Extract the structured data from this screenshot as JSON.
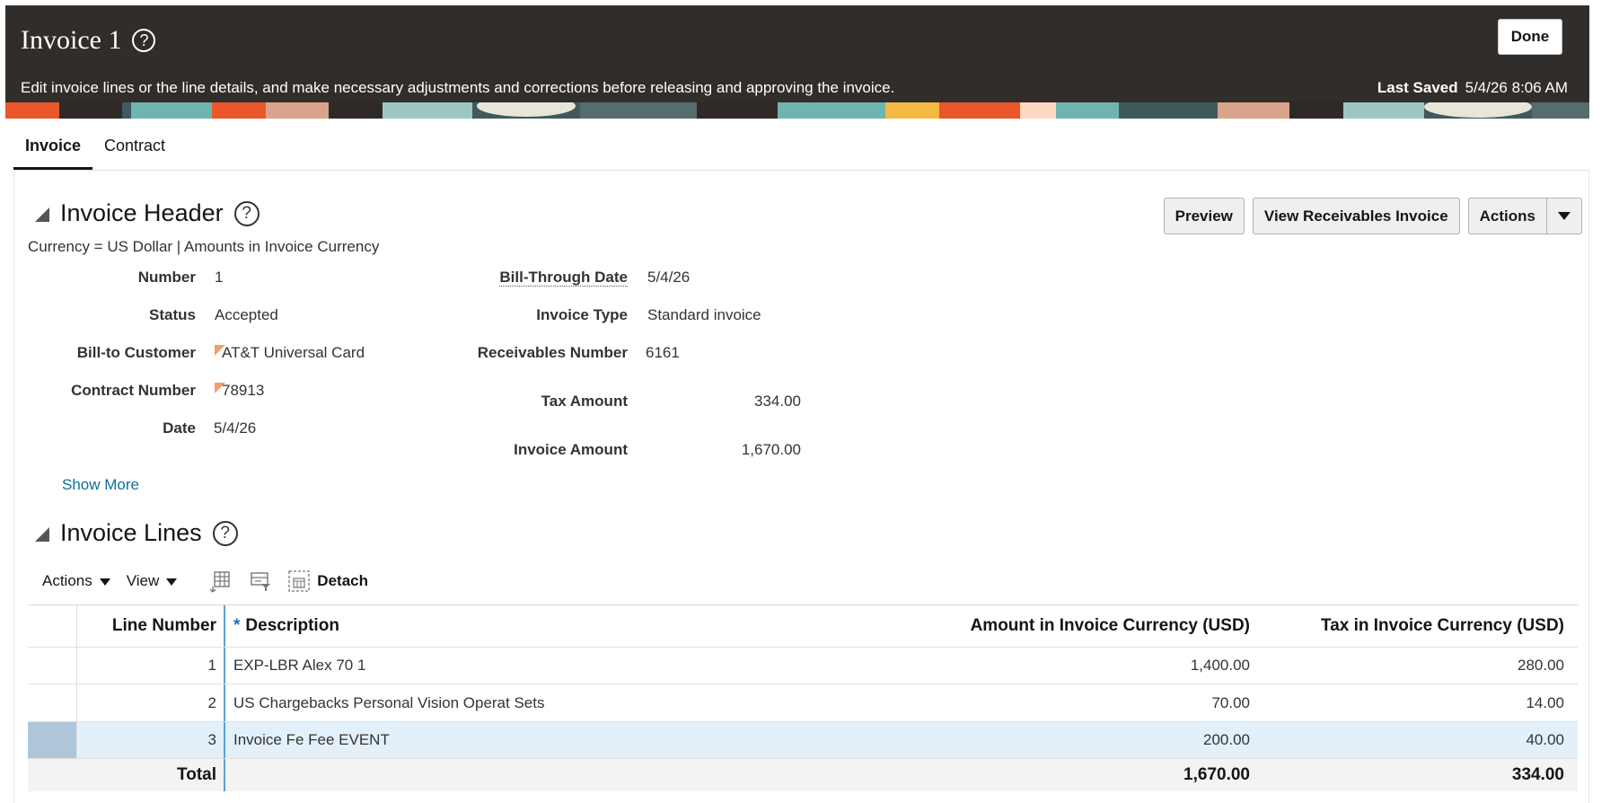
{
  "header": {
    "title": "Invoice 1",
    "help_icon": "question-circle-icon",
    "subtitle": "Edit invoice lines or the line details, and make necessary adjustments and corrections before releasing and approving the invoice.",
    "last_saved_label": "Last Saved",
    "last_saved_value": "5/4/26 8:06 AM",
    "done_label": "Done"
  },
  "tabs": [
    {
      "label": "Invoice",
      "active": true
    },
    {
      "label": "Contract",
      "active": false
    }
  ],
  "invoice_header": {
    "title": "Invoice Header",
    "currency_note": "Currency = US Dollar | Amounts in Invoice Currency",
    "buttons": {
      "preview": "Preview",
      "view_receivables": "View Receivables Invoice",
      "actions": "Actions"
    },
    "fields": {
      "number": {
        "label": "Number",
        "value": "1"
      },
      "status": {
        "label": "Status",
        "value": "Accepted"
      },
      "bill_to_customer": {
        "label": "Bill-to Customer",
        "value": "AT&T Universal Card"
      },
      "contract_number": {
        "label": "Contract Number",
        "value": "78913"
      },
      "date": {
        "label": "Date",
        "value": "5/4/26"
      },
      "bill_through_date": {
        "label": "Bill-Through Date",
        "value": "5/4/26"
      },
      "invoice_type": {
        "label": "Invoice Type",
        "value": "Standard invoice"
      },
      "receivables_number": {
        "label": "Receivables Number",
        "value": "6161"
      },
      "tax_amount": {
        "label": "Tax Amount",
        "value": "334.00"
      },
      "invoice_amount": {
        "label": "Invoice Amount",
        "value": "1,670.00"
      }
    },
    "show_more": "Show More"
  },
  "invoice_lines": {
    "title": "Invoice Lines",
    "toolbar": {
      "actions": "Actions",
      "view": "View",
      "detach": "Detach"
    },
    "columns": {
      "line_number": "Line Number",
      "description_marker": "*",
      "description": "Description",
      "amount": "Amount in Invoice Currency (USD)",
      "tax": "Tax in Invoice Currency (USD)"
    },
    "rows": [
      {
        "line": "1",
        "description": "EXP-LBR Alex 70 1",
        "amount": "1,400.00",
        "tax": "280.00"
      },
      {
        "line": "2",
        "description": "US Chargebacks Personal Vision Operat Sets",
        "amount": "70.00",
        "tax": "14.00"
      },
      {
        "line": "3",
        "description": "Invoice Fe Fee EVENT",
        "amount": "200.00",
        "tax": "40.00"
      }
    ],
    "total": {
      "label": "Total",
      "amount": "1,670.00",
      "tax": "334.00"
    }
  },
  "colors": {
    "banner_bg": "#312d2a",
    "link": "#0d6e9c",
    "selected_row": "#e4f0f9",
    "required_marker": "#1c73b8",
    "flag": "#f0a06a"
  }
}
